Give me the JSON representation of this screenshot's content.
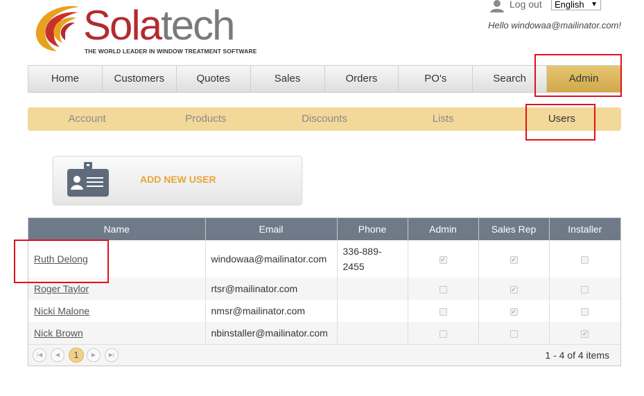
{
  "brand": {
    "name_part1": "Sola",
    "name_part2": "tech",
    "tagline": "THE WORLD LEADER IN WINDOW TREATMENT SOFTWARE"
  },
  "header": {
    "logout_label": "Log out",
    "language": "English",
    "greeting": "Hello windowaa@mailinator.com!"
  },
  "main_nav": [
    "Home",
    "Customers",
    "Quotes",
    "Sales",
    "Orders",
    "PO's",
    "Search",
    "Admin"
  ],
  "main_nav_active": "Admin",
  "sub_nav": [
    "Account",
    "Products",
    "Discounts",
    "Lists",
    "Users"
  ],
  "sub_nav_active": "Users",
  "add_user": {
    "label": "ADD NEW USER",
    "icon": "id-card-icon"
  },
  "grid": {
    "columns": [
      "Name",
      "Email",
      "Phone",
      "Admin",
      "Sales Rep",
      "Installer"
    ],
    "rows": [
      {
        "name": "Ruth Delong",
        "email": "windowaa@mailinator.com",
        "phone": "336-889-2455",
        "admin": true,
        "sales_rep": true,
        "installer": false
      },
      {
        "name": "Roger Taylor",
        "email": "rtsr@mailinator.com",
        "phone": "",
        "admin": false,
        "sales_rep": true,
        "installer": false
      },
      {
        "name": "Nicki Malone",
        "email": "nmsr@mailinator.com",
        "phone": "",
        "admin": false,
        "sales_rep": true,
        "installer": false
      },
      {
        "name": "Nick Brown",
        "email": "nbinstaller@mailinator.com",
        "phone": "",
        "admin": false,
        "sales_rep": false,
        "installer": true
      }
    ],
    "pager": {
      "current_page": "1",
      "info": "1 - 4 of 4 items"
    }
  },
  "colors": {
    "accent_gold": "#d0a84a",
    "sub_nav_bg": "#f2d99a",
    "header_gray": "#6f7a89",
    "highlight_red": "#e0101a",
    "brand_red": "#b32b2f"
  }
}
